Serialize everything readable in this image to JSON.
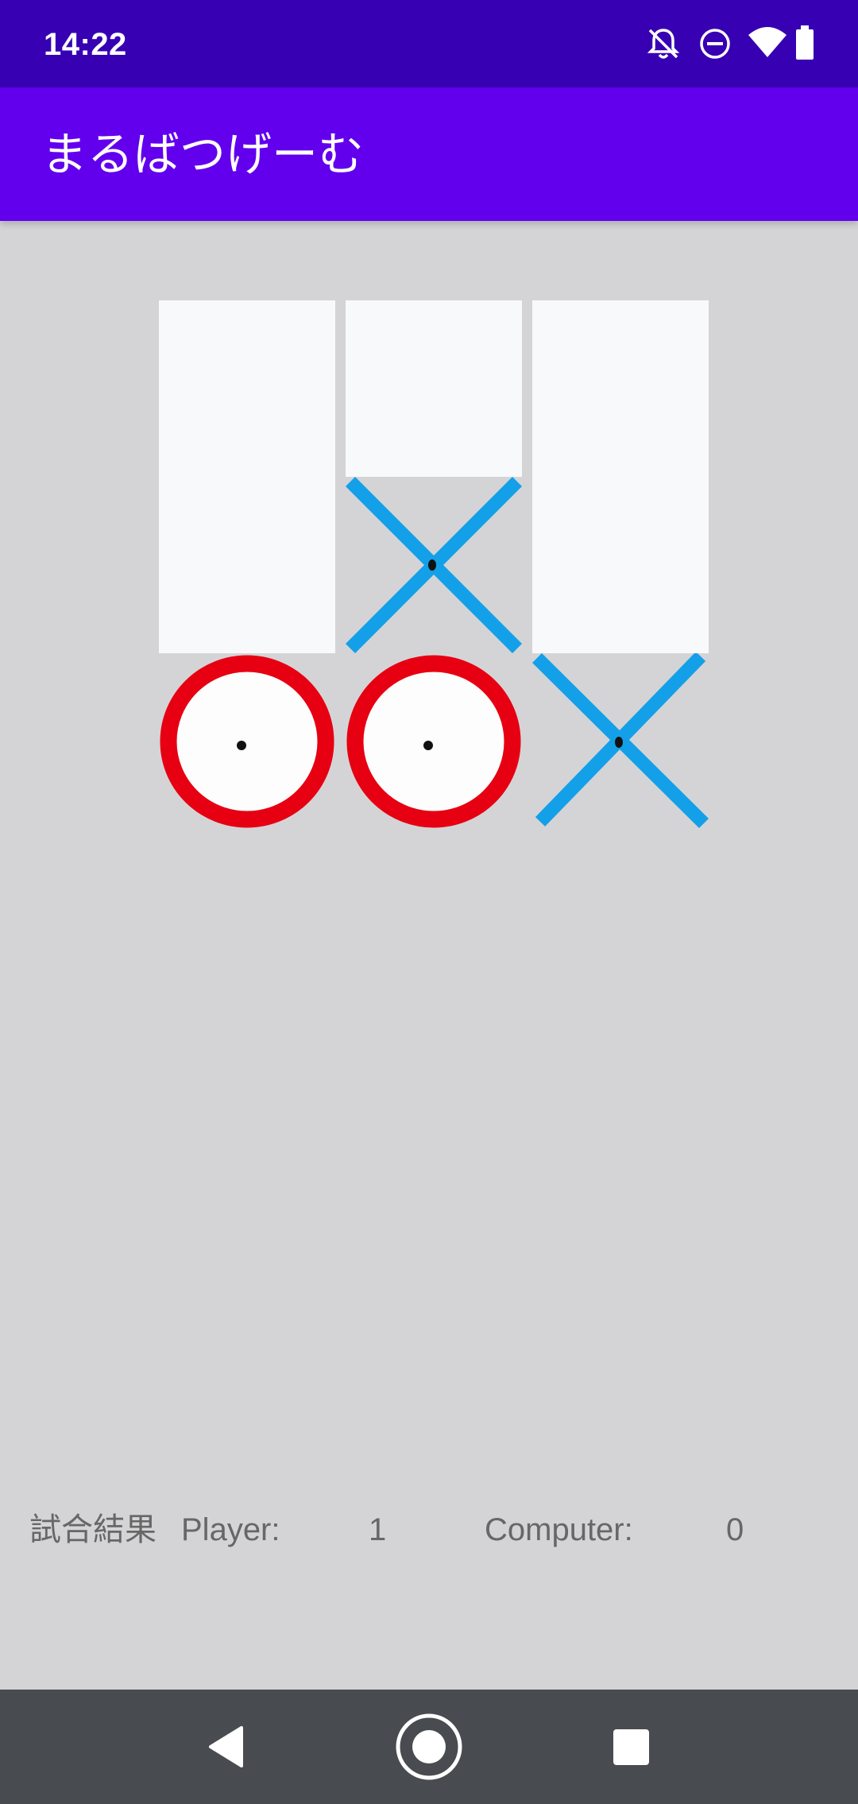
{
  "status_bar": {
    "time": "14:22",
    "icons": [
      "notifications-off-icon",
      "do-not-disturb-icon",
      "wifi-icon",
      "battery-icon"
    ]
  },
  "app_bar": {
    "title": "まるばつげーむ",
    "color": "#6200ee"
  },
  "board": {
    "cells": [
      {
        "row": 1,
        "col": 1,
        "mark": ""
      },
      {
        "row": 1,
        "col": 2,
        "mark": ""
      },
      {
        "row": 1,
        "col": 3,
        "mark": ""
      },
      {
        "row": 2,
        "col": 1,
        "mark": ""
      },
      {
        "row": 2,
        "col": 2,
        "mark": "×"
      },
      {
        "row": 2,
        "col": 3,
        "mark": ""
      },
      {
        "row": 3,
        "col": 1,
        "mark": "○"
      },
      {
        "row": 3,
        "col": 2,
        "mark": "○"
      },
      {
        "row": 3,
        "col": 3,
        "mark": "×"
      }
    ],
    "maru_color": "#e60012",
    "batsu_color": "#13a0e8"
  },
  "score": {
    "label": "試合結果",
    "player_label": "Player:",
    "player_score": "1",
    "computer_label": "Computer:",
    "computer_score": "0"
  },
  "nav_bar": {
    "buttons": [
      "back-icon",
      "home-icon",
      "recents-icon"
    ]
  }
}
